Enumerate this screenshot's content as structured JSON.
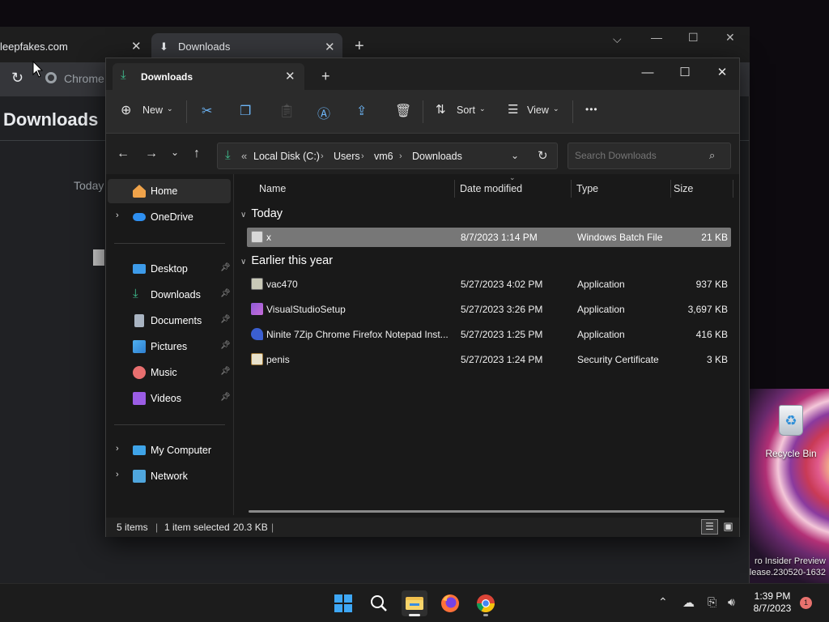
{
  "desktop": {
    "recycle_bin_label": "Recycle Bin",
    "watermark_line1": "ro Insider Preview",
    "watermark_line2": "lease.230520-1632"
  },
  "chrome": {
    "tab1_title": "leepfakes.com",
    "tab2_title": "Downloads",
    "omnibox_text": "Chrome",
    "page_title": "Downloads",
    "section_today": "Today"
  },
  "explorer": {
    "tab_title": "Downloads",
    "commands": {
      "new": "New",
      "sort": "Sort",
      "view": "View",
      "more": "•••"
    },
    "address": {
      "overflow": "«",
      "crumbs": [
        "Local Disk (C:)",
        "Users",
        "vm6",
        "Downloads"
      ]
    },
    "search_placeholder": "Search Downloads",
    "sidebar": {
      "home": "Home",
      "onedrive": "OneDrive",
      "desktop": "Desktop",
      "downloads": "Downloads",
      "documents": "Documents",
      "pictures": "Pictures",
      "music": "Music",
      "videos": "Videos",
      "my_computer": "My Computer",
      "network": "Network"
    },
    "columns": {
      "name": "Name",
      "date": "Date modified",
      "type": "Type",
      "size": "Size"
    },
    "groups": {
      "today": "Today",
      "earlier": "Earlier this year"
    },
    "files": [
      {
        "name": "x",
        "date": "8/7/2023 1:14 PM",
        "type": "Windows Batch File",
        "size": "21 KB"
      },
      {
        "name": "vac470",
        "date": "5/27/2023 4:02 PM",
        "type": "Application",
        "size": "937 KB"
      },
      {
        "name": "VisualStudioSetup",
        "date": "5/27/2023 3:26 PM",
        "type": "Application",
        "size": "3,697 KB"
      },
      {
        "name": "Ninite 7Zip Chrome Firefox Notepad Inst...",
        "date": "5/27/2023 1:25 PM",
        "type": "Application",
        "size": "416 KB"
      },
      {
        "name": "penis",
        "date": "5/27/2023 1:24 PM",
        "type": "Security Certificate",
        "size": "3 KB"
      }
    ],
    "status": {
      "items": "5 items",
      "selected": "1 item selected",
      "selected_size": "20.3 KB"
    }
  },
  "taskbar": {
    "time": "1:39 PM",
    "date": "8/7/2023",
    "notification_count": "1"
  },
  "colors": {
    "accent": "#6cb4f5",
    "selection": "#777777",
    "download_green": "#3fbf8f"
  }
}
